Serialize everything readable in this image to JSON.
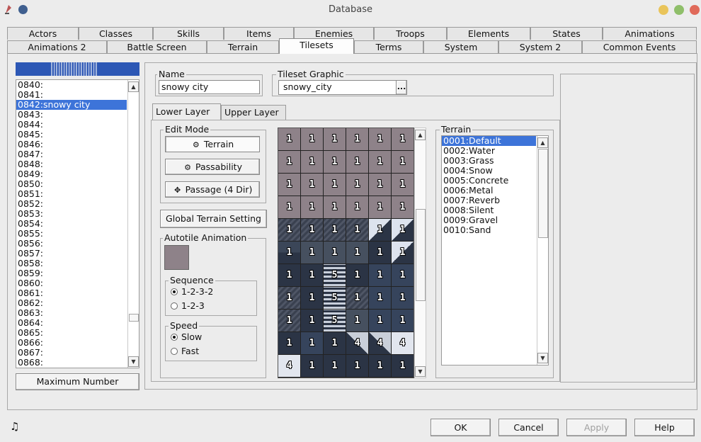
{
  "window": {
    "title": "Database"
  },
  "tabs_row1": [
    "Actors",
    "Classes",
    "Skills",
    "Items",
    "Enemies",
    "Troops",
    "Elements",
    "States",
    "Animations"
  ],
  "tabs_row2": [
    "Animations 2",
    "Battle Screen",
    "Terrain",
    "Tilesets",
    "Terms",
    "System",
    "System 2",
    "Common Events"
  ],
  "active_tab": "Tilesets",
  "tileset_list": {
    "items": [
      "0840:",
      "0841:",
      "0842:snowy city",
      "0843:",
      "0844:",
      "0845:",
      "0846:",
      "0847:",
      "0848:",
      "0849:",
      "0850:",
      "0851:",
      "0852:",
      "0853:",
      "0854:",
      "0855:",
      "0856:",
      "0857:",
      "0858:",
      "0859:",
      "0860:",
      "0861:",
      "0862:",
      "0863:",
      "0864:",
      "0865:",
      "0866:",
      "0867:",
      "0868:"
    ],
    "selected": "0842:snowy city",
    "max_button": "Maximum Number"
  },
  "name": {
    "label": "Name",
    "value": "snowy city"
  },
  "graphic": {
    "label": "Tileset Graphic",
    "value": "snowy_city",
    "browse": "..."
  },
  "layer_tabs": [
    "Lower Layer",
    "Upper Layer"
  ],
  "edit_mode": {
    "label": "Edit Mode",
    "terrain": "Terrain",
    "passability": "Passability",
    "passage": "Passage (4 Dir)"
  },
  "global_terrain": "Global Terrain Setting",
  "autotile": {
    "label": "Autotile Animation",
    "color": "#8e8289"
  },
  "sequence": {
    "label": "Sequence",
    "options": [
      "1-2-3-2",
      "1-2-3"
    ],
    "selected": "1-2-3-2"
  },
  "speed": {
    "label": "Speed",
    "options": [
      "Slow",
      "Fast"
    ],
    "selected": "Slow"
  },
  "tiles": [
    [
      "1",
      "1",
      "1",
      "1",
      "1",
      "1"
    ],
    [
      "1",
      "1",
      "1",
      "1",
      "1",
      "1"
    ],
    [
      "1",
      "1",
      "1",
      "1",
      "1",
      "1"
    ],
    [
      "1",
      "1",
      "1",
      "1",
      "1",
      "1"
    ],
    [
      "1",
      "1",
      "1",
      "1",
      "1",
      "1"
    ],
    [
      "1",
      "1",
      "1",
      "1",
      "1",
      "1"
    ],
    [
      "1",
      "1",
      "5",
      "1",
      "1",
      "1"
    ],
    [
      "1",
      "1",
      "5",
      "1",
      "1",
      "1"
    ],
    [
      "1",
      "1",
      "5",
      "1",
      "1",
      "1"
    ],
    [
      "1",
      "1",
      "1",
      "4",
      "4",
      "4"
    ],
    [
      "4",
      "1",
      "1",
      "1",
      "1",
      "1"
    ]
  ],
  "terrain": {
    "label": "Terrain",
    "items": [
      "0001:Default",
      "0002:Water",
      "0003:Grass",
      "0004:Snow",
      "0005:Concrete",
      "0006:Metal",
      "0007:Reverb",
      "0008:Silent",
      "0009:Gravel",
      "0010:Sand"
    ],
    "selected": "0001:Default"
  },
  "footer": {
    "ok": "OK",
    "cancel": "Cancel",
    "apply": "Apply",
    "help": "Help"
  }
}
